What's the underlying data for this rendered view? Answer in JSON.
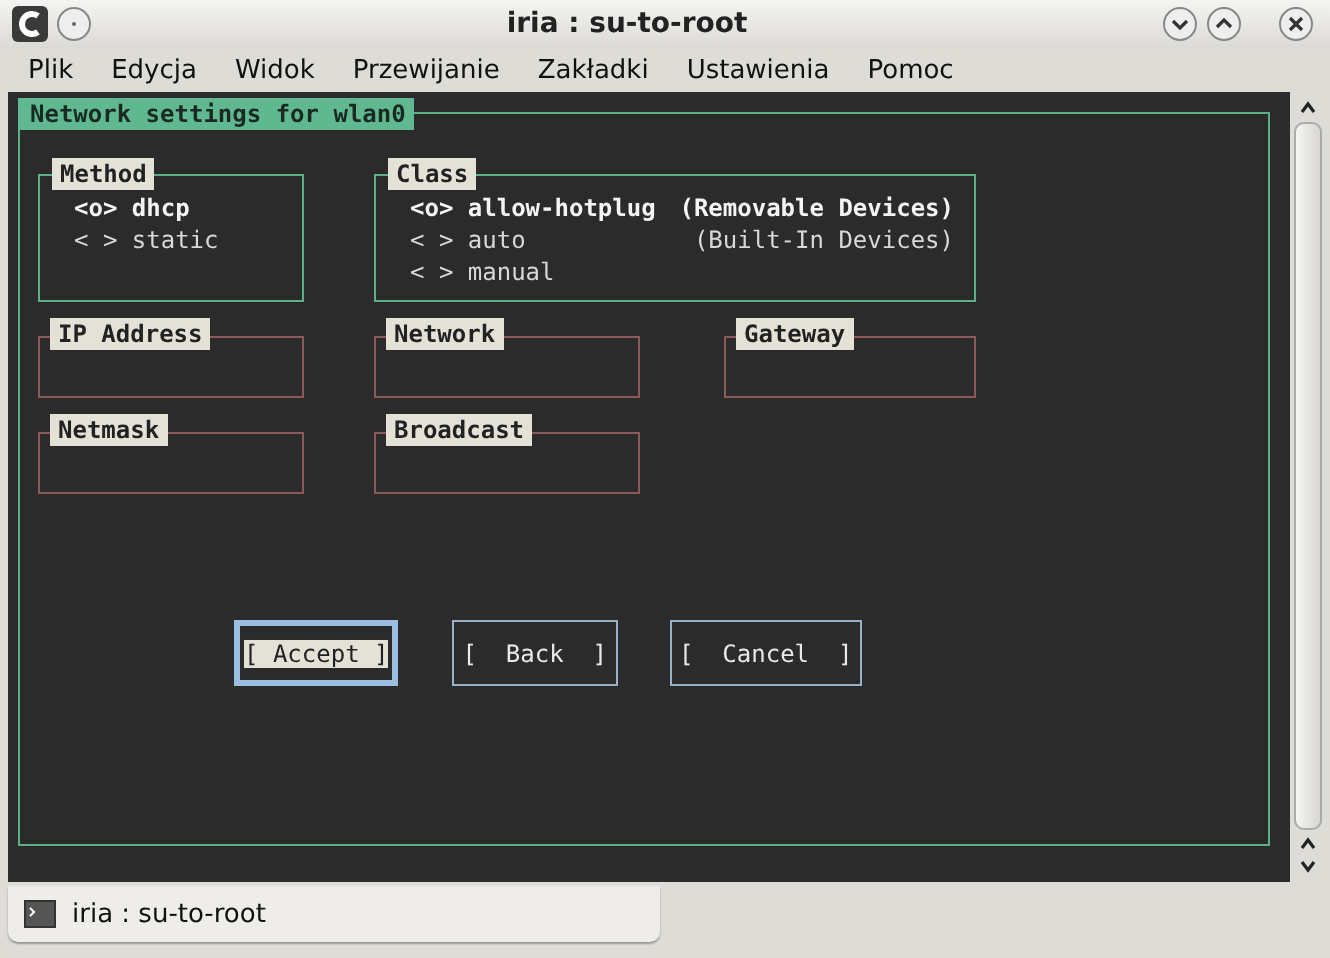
{
  "window": {
    "title": "iria : su-to-root"
  },
  "menu": [
    "Plik",
    "Edycja",
    "Widok",
    "Przewijanie",
    "Zakładki",
    "Ustawienia",
    "Pomoc"
  ],
  "dialog": {
    "title": "Network settings for wlan0",
    "method": {
      "label": "Method",
      "options": [
        {
          "mark": "<o>",
          "label": "dhcp",
          "selected": true
        },
        {
          "mark": "< >",
          "label": "static",
          "selected": false
        }
      ]
    },
    "class": {
      "label": "Class",
      "options": [
        {
          "mark": "<o>",
          "label": "allow-hotplug",
          "note": "(Removable Devices)",
          "selected": true
        },
        {
          "mark": "< >",
          "label": "auto",
          "note": "(Built-In Devices)",
          "selected": false
        },
        {
          "mark": "< >",
          "label": "manual",
          "selected": false
        }
      ]
    },
    "fields": [
      {
        "label": "IP Address"
      },
      {
        "label": "Network"
      },
      {
        "label": "Gateway"
      },
      {
        "label": "Netmask"
      },
      {
        "label": "Broadcast"
      }
    ],
    "buttons": [
      {
        "label": "[ Accept ]",
        "selected": true
      },
      {
        "label": "[  Back  ]",
        "selected": false
      },
      {
        "label": "[  Cancel  ]",
        "selected": false
      }
    ]
  },
  "tabs": [
    {
      "label": "iria : su-to-root",
      "selected": true
    }
  ]
}
